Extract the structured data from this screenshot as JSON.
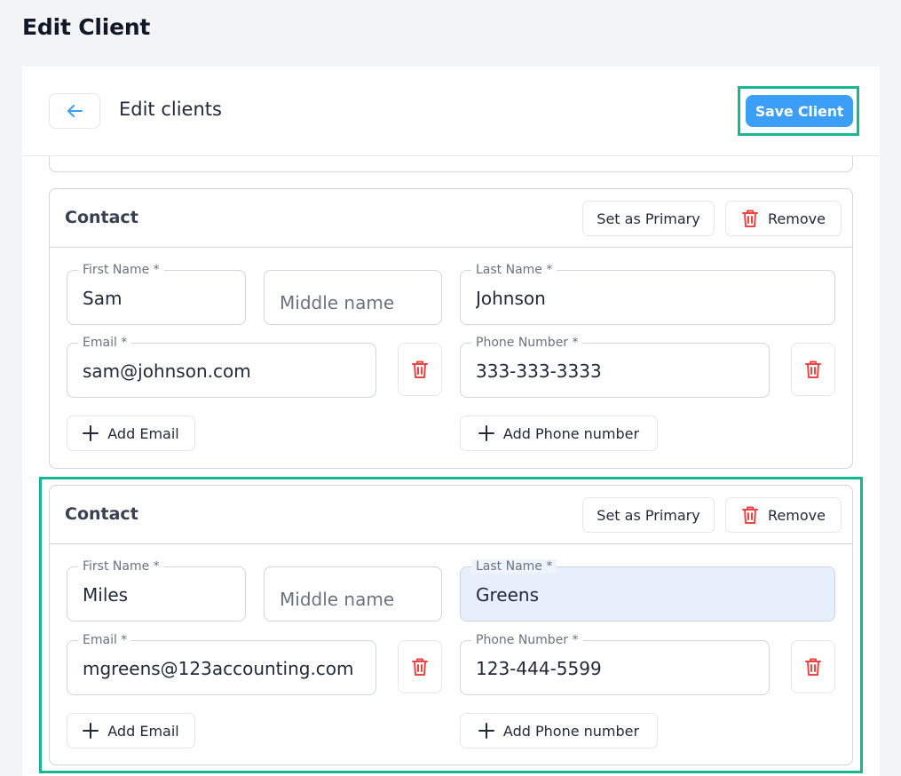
{
  "page": {
    "title": "Edit Client"
  },
  "header": {
    "back_icon": "arrow-left-icon",
    "title": "Edit clients",
    "save_label": "Save Client"
  },
  "colors": {
    "accent": "#3b9ef7",
    "highlight": "#16b892",
    "danger": "#ef4444",
    "filled_bg": "#e8effc"
  },
  "contacts": [
    {
      "title": "Contact",
      "set_primary_label": "Set as Primary",
      "remove_label": "Remove",
      "first_name": {
        "label": "First Name *",
        "value": "Sam"
      },
      "middle_name": {
        "placeholder": "Middle name",
        "value": ""
      },
      "last_name": {
        "label": "Last Name *",
        "value": "Johnson"
      },
      "email": {
        "label": "Email *",
        "value": "sam@johnson.com"
      },
      "phone": {
        "label": "Phone Number *",
        "value": "333-333-3333"
      },
      "add_email_label": "Add Email",
      "add_phone_label": "Add Phone number"
    },
    {
      "title": "Contact",
      "set_primary_label": "Set as Primary",
      "remove_label": "Remove",
      "first_name": {
        "label": "First Name *",
        "value": "Miles"
      },
      "middle_name": {
        "placeholder": "Middle name",
        "value": ""
      },
      "last_name": {
        "label": "Last Name *",
        "value": "Greens"
      },
      "email": {
        "label": "Email *",
        "value": "mgreens@123accounting.com"
      },
      "phone": {
        "label": "Phone Number *",
        "value": "123-444-5599"
      },
      "add_email_label": "Add Email",
      "add_phone_label": "Add Phone number"
    }
  ]
}
